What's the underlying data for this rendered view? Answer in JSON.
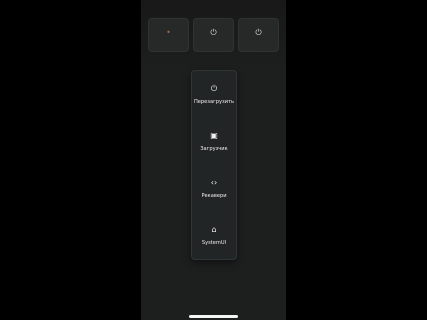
{
  "top_controls": [
    {
      "icon": "•",
      "label": "",
      "icon_name": "dot-icon"
    },
    {
      "icon": "⏻",
      "label": "",
      "icon_name": "power-icon"
    },
    {
      "icon": "⏻",
      "label": "",
      "icon_name": "power-icon"
    }
  ],
  "background_title": "",
  "menu": [
    {
      "icon": "⏻",
      "label": "Перезагрузить",
      "icon_name": "restart-icon"
    },
    {
      "icon": "▣",
      "label": "Загрузчик",
      "icon_name": "bootloader-icon"
    },
    {
      "icon": "‹›",
      "label": "Рекавери",
      "icon_name": "recovery-icon"
    },
    {
      "icon": "⌂",
      "label": "SystemUI",
      "icon_name": "systemui-icon"
    }
  ],
  "colors": {
    "background": "#000000",
    "screen": "#1d1e1e",
    "menu": "#222525",
    "text": "#f0f0f0",
    "accent": "#9a674f"
  }
}
